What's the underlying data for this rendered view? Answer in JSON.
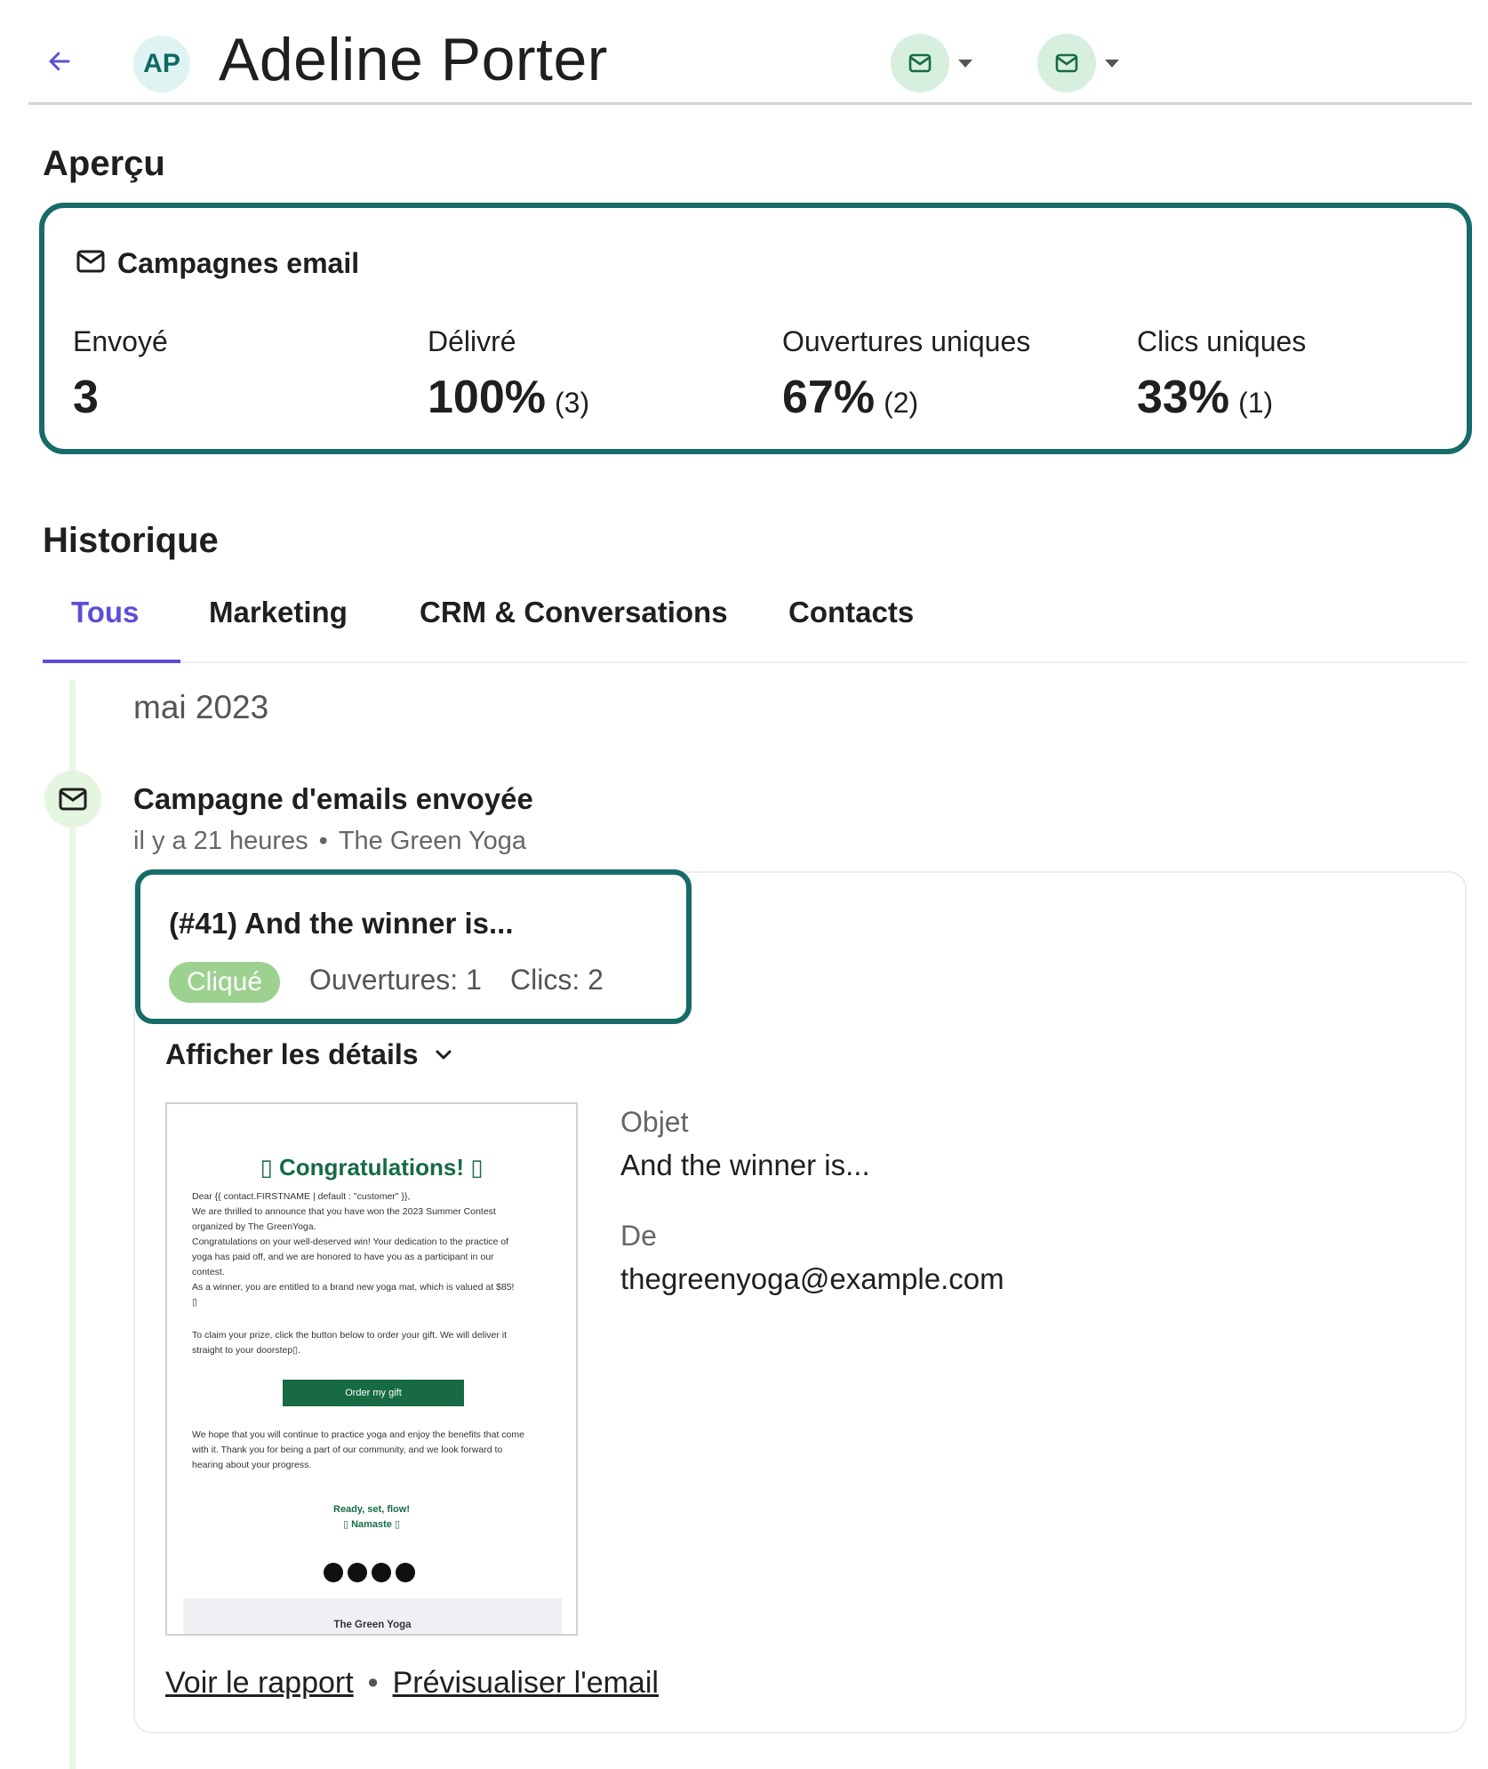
{
  "header": {
    "avatar_initials": "AP",
    "contact_name": "Adeline Porter",
    "back_icon": "arrow-left-icon",
    "email_toggle_icon": "envelope-icon"
  },
  "overview": {
    "title": "Aperçu",
    "card_title": "Campagnes email",
    "metrics": [
      {
        "label": "Envoyé",
        "value": "3",
        "sub": ""
      },
      {
        "label": "Délivré",
        "value": "100%",
        "sub": "(3)"
      },
      {
        "label": "Ouvertures uniques",
        "value": "67%",
        "sub": "(2)"
      },
      {
        "label": "Clics uniques",
        "value": "33%",
        "sub": "(1)"
      }
    ]
  },
  "history": {
    "title": "Historique",
    "tabs": [
      {
        "label": "Tous",
        "active": true
      },
      {
        "label": "Marketing",
        "active": false
      },
      {
        "label": "CRM & Conversations",
        "active": false
      },
      {
        "label": "Contacts",
        "active": false
      }
    ],
    "month": "mai 2023",
    "event": {
      "title": "Campagne d'emails envoyée",
      "time": "il y a 21 heures",
      "separator": "•",
      "sender_name": "The Green Yoga",
      "campaign_name": "(#41) And the winner is...",
      "badge": "Cliqué",
      "opens": "Ouvertures: 1",
      "clicks": "Clics: 2",
      "details_toggle": "Afficher les détails",
      "subject_label": "Objet",
      "subject_value": "And the winner is...",
      "from_label": "De",
      "from_value": "thegreenyoga@example.com",
      "link_report": "Voir le rapport",
      "link_separator": "•",
      "link_preview": "Prévisualiser l'email"
    }
  },
  "email_preview": {
    "title": "▯ Congratulations! ▯",
    "lines": [
      "Dear {{ contact.FIRSTNAME | default : \"customer\" }},",
      "We are thrilled to announce that you have won the 2023 Summer Contest",
      "organized by The GreenYoga.",
      "Congratulations on your well-deserved win! Your dedication to the practice of",
      "yoga has paid off, and we are honored to have you as a participant in our",
      "contest.",
      "As a winner, you are entitled to a brand new yoga mat, which is valued at $85!",
      "▯"
    ],
    "claim_lines": [
      "To claim your prize, click the button below to order your gift. We will deliver it",
      "straight to your doorstep▯."
    ],
    "button": "Order my gift",
    "closing_lines": [
      "We hope that you will continue to practice yoga and enjoy the benefits that come",
      "with it. Thank you for being a part of our community, and we look forward to",
      "hearing about your progress."
    ],
    "sign_1": "Ready, set, flow!",
    "sign_2": "▯ Namaste ▯",
    "social_icons": [
      "instagram-icon",
      "facebook-icon",
      "globe-icon",
      "twitter-icon"
    ],
    "footer": "The Green Yoga"
  },
  "colors": {
    "accent": "#5b4fd6",
    "highlight_border": "#176b69",
    "badge_bg": "#9dd18f",
    "brand_green": "#176b44"
  }
}
